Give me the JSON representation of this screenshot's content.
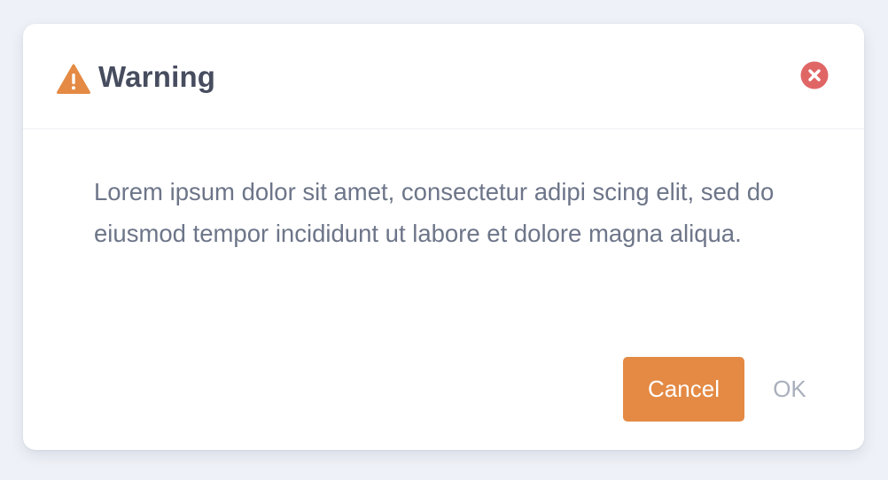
{
  "dialog": {
    "icon": "warning-triangle-icon",
    "title": "Warning",
    "close_icon": "close-circle-icon",
    "message": "Lorem ipsum dolor sit amet, consectetur adipi scing elit, sed do eiusmod tempor incididunt ut labore et dolore magna aliqua.",
    "buttons": {
      "cancel_label": "Cancel",
      "ok_label": "OK"
    }
  },
  "colors": {
    "page_background": "#eef1f7",
    "warning_accent": "#e48a44",
    "close_icon": "#e06666",
    "title_text": "#474d5f",
    "body_text": "#6d7589",
    "ok_text": "#a9afbc"
  }
}
